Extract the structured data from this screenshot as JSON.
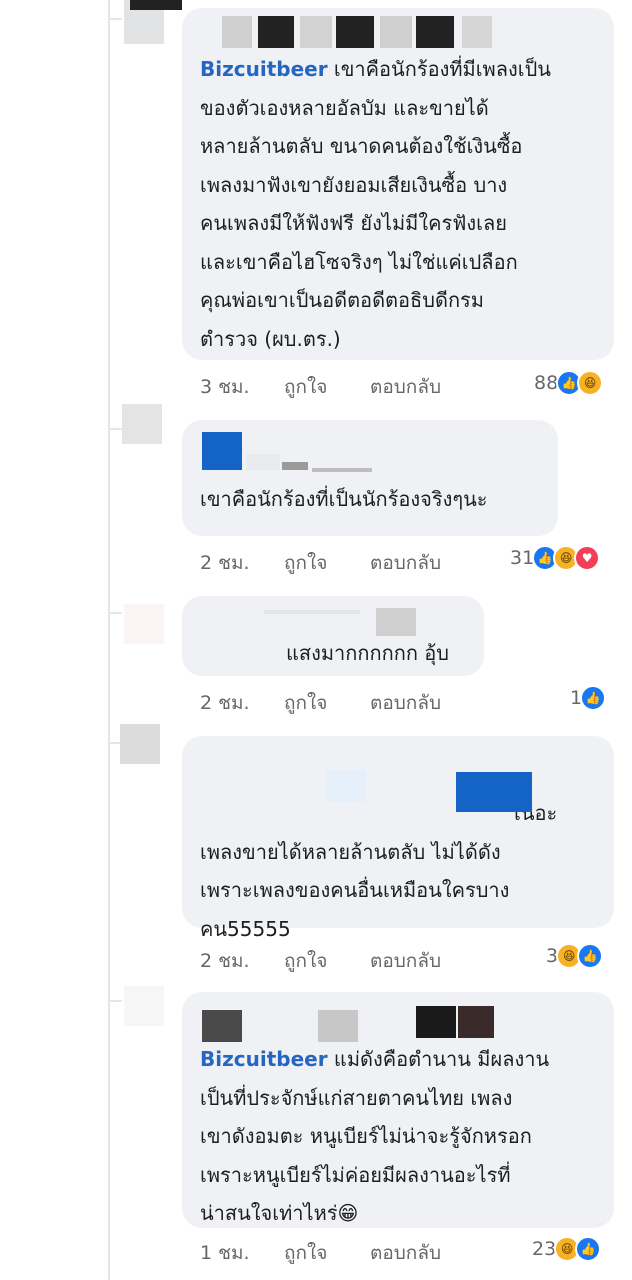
{
  "comments": [
    {
      "author": "Bizcuitbeer",
      "text": "เขาคือนักร้องที่มีเพลงเป็น\nของตัวเองหลายอัลบัม และขายได้\nหลายล้านตลับ ขนาดคนต้องใช้เงินซื้อ\nเพลงมาฟังเขายังยอมเสียเงินซื้อ บาง\nคนเพลงมีให้ฟังฟรี ยังไม่มีใครฟังเลย\nและเขาคือไฮโซจริงๆ ไม่ใช่แค่เปลือก\nคุณพ่อเขาเป็นอดีตอดีตอธิบดีกรม\nตำรวจ (ผบ.ตร.)",
      "time": "3 ชม.",
      "like": "ถูกใจ",
      "reply": "ตอบกลับ",
      "reaction_count": "88",
      "reactions": [
        "like-icon",
        "haha-icon"
      ]
    },
    {
      "author": "",
      "text": "เขาคือนักร้องที่เป็นนักร้องจริงๆนะ",
      "time": "2 ชม.",
      "like": "ถูกใจ",
      "reply": "ตอบกลับ",
      "reaction_count": "31",
      "reactions": [
        "like-icon",
        "haha-icon",
        "love-icon"
      ]
    },
    {
      "author": "",
      "text": "แสงมากกกกกก อุ้บ",
      "time": "2 ชม.",
      "like": "ถูกใจ",
      "reply": "ตอบกลับ",
      "reaction_count": "1",
      "reactions": [
        "like-icon"
      ]
    },
    {
      "author": "",
      "text_first_line": "เนอะ",
      "text": "เพลงขายได้หลายล้านตลับ ไม่ได้ดัง\nเพราะเพลงของคนอื่นเหมือนใครบาง\nคน55555",
      "time": "2 ชม.",
      "like": "ถูกใจ",
      "reply": "ตอบกลับ",
      "reaction_count": "3",
      "reactions": [
        "haha-icon",
        "like-icon"
      ]
    },
    {
      "author": "Bizcuitbeer",
      "text": "แม่ดังคือตำนาน มีผลงาน\nเป็นที่ประจักษ์แก่สายตาคนไทย เพลง\nเขาดังอมตะ หนูเบียร์ไม่น่าจะรู้จักหรอก\nเพราะหนูเบียร์ไม่ค่อยมีผลงานอะไรที่\nน่าสนใจเท่าไหร่😁",
      "time": "1 ชม.",
      "like": "ถูกใจ",
      "reply": "ตอบกลับ",
      "reaction_count": "23",
      "reactions": [
        "haha-icon",
        "like-icon"
      ]
    }
  ]
}
